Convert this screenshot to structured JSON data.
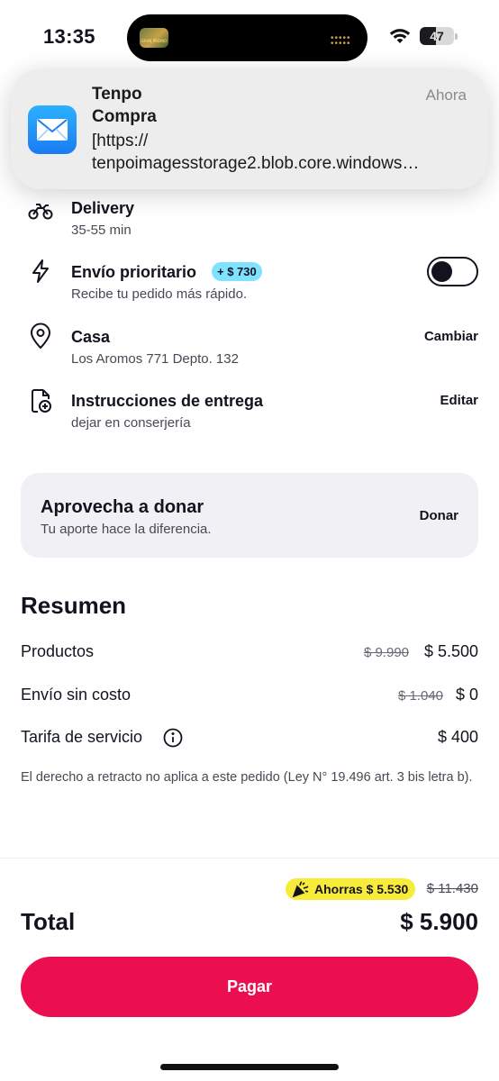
{
  "status_bar": {
    "time": "13:35",
    "battery": "47",
    "island_thumb_text": "GRAN PREMIO",
    "icons": [
      "wifi-icon",
      "battery-icon"
    ]
  },
  "notification": {
    "app_icon": "mail-icon",
    "title": "Tenpo",
    "subtitle": "Compra",
    "body": "[https://\ntenpoimagesstorage2.blob.core.windows…",
    "time": "Ahora"
  },
  "delivery": {
    "method": {
      "icon": "motorcycle-icon",
      "title": "Delivery",
      "subtitle": "35-55 min"
    },
    "priority": {
      "icon": "lightning-icon",
      "title": "Envío prioritario",
      "badge": "+ $ 730",
      "subtitle": "Recibe tu pedido más rápido.",
      "toggle_on": false
    },
    "address": {
      "icon": "location-pin-icon",
      "title": "Casa",
      "subtitle": "Los Aromos 771 Depto. 132",
      "action": "Cambiar"
    },
    "instructions": {
      "icon": "document-add-icon",
      "title": "Instrucciones de entrega",
      "subtitle": "dejar en conserjería",
      "action": "Editar"
    }
  },
  "donate": {
    "title": "Aprovecha a donar",
    "subtitle": "Tu aporte hace la diferencia.",
    "button": "Donar"
  },
  "summary": {
    "title": "Resumen",
    "rows": [
      {
        "label": "Productos",
        "original": "$ 9.990",
        "value": "$ 5.500"
      },
      {
        "label": "Envío sin costo",
        "original": "$ 1.040",
        "value": "$ 0"
      },
      {
        "label": "Tarifa de servicio",
        "original": "",
        "value": "$ 400",
        "icon": "info-icon"
      }
    ],
    "legal_note": "El derecho a retracto no aplica a este pedido (Ley N° 19.496 art. 3 bis letra b)."
  },
  "checkout": {
    "savings_label": "Ahorras $ 5.530",
    "savings_icon": "party-popper-icon",
    "original_total": "$ 11.430",
    "total_label": "Total",
    "total_value": "$ 5.900",
    "pay_button": "Pagar"
  },
  "colors": {
    "accent": "#ec0f4f",
    "priority_badge": "#7fe3ff",
    "savings_badge": "#f8ec3b",
    "text": "#15121f",
    "muted": "#4b4754",
    "card_bg": "#f1f1f5"
  }
}
